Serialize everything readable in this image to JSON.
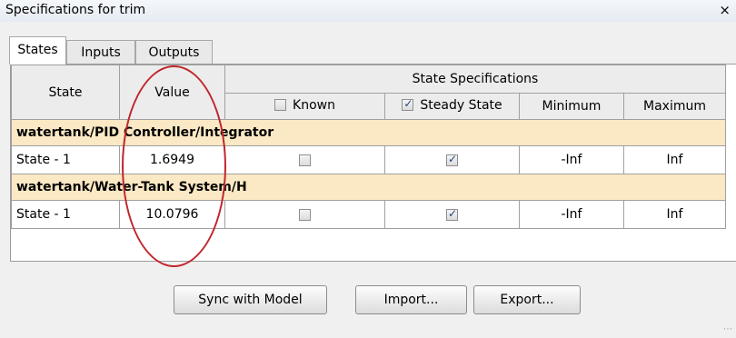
{
  "window": {
    "title": "Specifications for trim",
    "close_glyph": "×"
  },
  "tabs": [
    {
      "label": "States",
      "active": true
    },
    {
      "label": "Inputs",
      "active": false
    },
    {
      "label": "Outputs",
      "active": false
    }
  ],
  "table": {
    "headers": {
      "state": "State",
      "value": "Value",
      "group": "State Specifications",
      "known": "Known",
      "steady_state": "Steady State",
      "minimum": "Minimum",
      "maximum": "Maximum"
    },
    "header_checkboxes": {
      "known": false,
      "steady_state": true
    },
    "groups": [
      {
        "block": "watertank/PID Controller/Integrator",
        "rows": [
          {
            "state": "State - 1",
            "value": "1.6949",
            "known": false,
            "steady_state": true,
            "minimum": "-Inf",
            "maximum": "Inf"
          }
        ]
      },
      {
        "block": "watertank/Water-Tank System/H",
        "rows": [
          {
            "state": "State - 1",
            "value": "10.0796",
            "known": false,
            "steady_state": true,
            "minimum": "-Inf",
            "maximum": "Inf"
          }
        ]
      }
    ]
  },
  "buttons": {
    "sync": "Sync with Model",
    "import": "Import...",
    "export": "Export..."
  },
  "colors": {
    "group_row": "#fbe8c4",
    "annotation_oval": "#c0262c",
    "checkbox_check": "#24427a"
  }
}
